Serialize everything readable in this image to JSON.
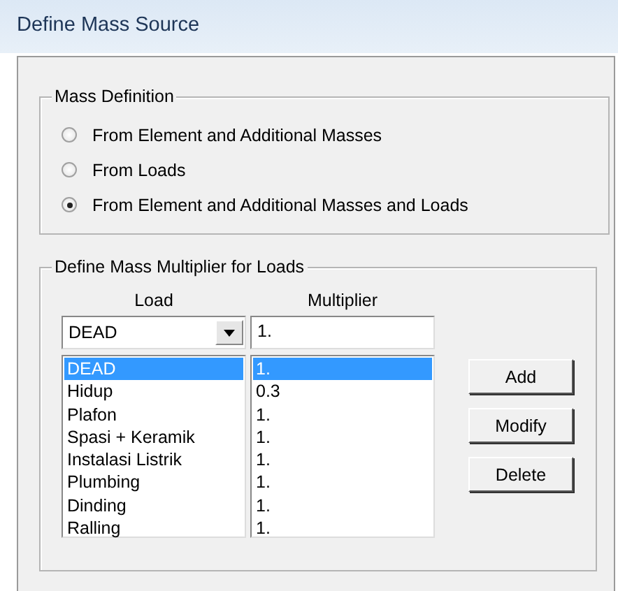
{
  "window": {
    "title": "Define Mass Source"
  },
  "mass_definition": {
    "title": "Mass Definition",
    "options": [
      {
        "label": "From Element and Additional Masses",
        "selected": false
      },
      {
        "label": "From Loads",
        "selected": false
      },
      {
        "label": "From Element and Additional Masses and Loads",
        "selected": true
      }
    ]
  },
  "multiplier_group": {
    "title": "Define Mass Multiplier for Loads",
    "load_header": "Load",
    "multiplier_header": "Multiplier",
    "load_combo": {
      "value": "DEAD"
    },
    "multiplier_field": {
      "value": "1."
    },
    "rows": [
      {
        "load": "DEAD",
        "multiplier": "1.",
        "selected": true
      },
      {
        "load": "Hidup",
        "multiplier": "0.3",
        "selected": false
      },
      {
        "load": "Plafon",
        "multiplier": "1.",
        "selected": false
      },
      {
        "load": "Spasi + Keramik",
        "multiplier": "1.",
        "selected": false
      },
      {
        "load": "Instalasi Listrik",
        "multiplier": "1.",
        "selected": false
      },
      {
        "load": "Plumbing",
        "multiplier": "1.",
        "selected": false
      },
      {
        "load": "Dinding",
        "multiplier": "1.",
        "selected": false
      },
      {
        "load": "Ralling",
        "multiplier": "1.",
        "selected": false
      }
    ],
    "buttons": [
      "Add",
      "Modify",
      "Delete"
    ]
  }
}
